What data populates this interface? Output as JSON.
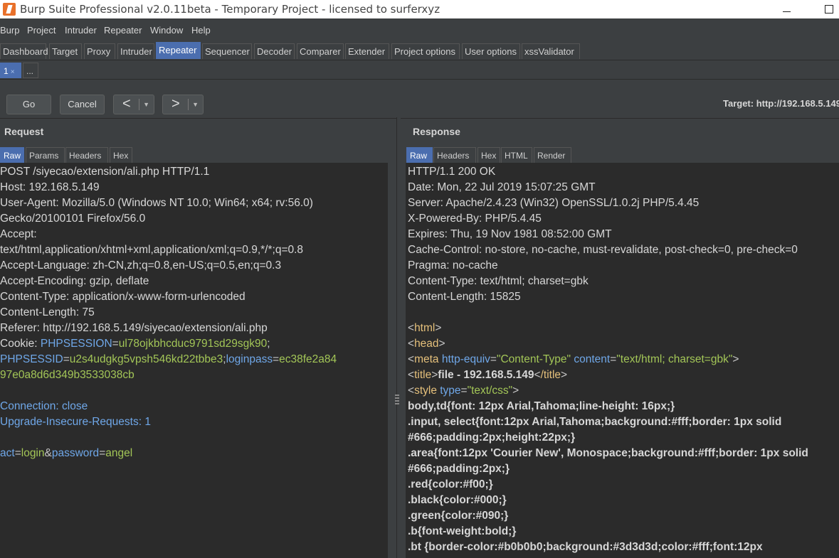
{
  "window": {
    "title": "Burp Suite Professional v2.0.11beta - Temporary Project - licensed to surferxyz"
  },
  "menubar": [
    "Burp",
    "Project",
    "Intruder",
    "Repeater",
    "Window",
    "Help"
  ],
  "main_tabs": [
    "Dashboard",
    "Target",
    "Proxy",
    "Intruder",
    "Repeater",
    "Sequencer",
    "Decoder",
    "Comparer",
    "Extender",
    "Project options",
    "User options",
    "xssValidator"
  ],
  "main_tabs_active": "Repeater",
  "repeater_tabs": {
    "tab1": "1",
    "close": "×",
    "more": "..."
  },
  "toolbar": {
    "go": "Go",
    "cancel": "Cancel",
    "back": "<",
    "forward": ">",
    "dropdown": "▼",
    "target": "Target: http://192.168.5.149"
  },
  "request": {
    "title": "Request",
    "tabs": [
      "Raw",
      "Params",
      "Headers",
      "Hex"
    ],
    "active_tab": "Raw",
    "lines": {
      "l1": "POST /siyecao/extension/ali.php HTTP/1.1",
      "l2": "Host: 192.168.5.149",
      "l3": "User-Agent: Mozilla/5.0 (Windows NT 10.0; Win64; x64; rv:56.0)",
      "l4": "Gecko/20100101 Firefox/56.0",
      "l5": "Accept:",
      "l6": "text/html,application/xhtml+xml,application/xml;q=0.9,*/*;q=0.8",
      "l7": "Accept-Language: zh-CN,zh;q=0.8,en-US;q=0.5,en;q=0.3",
      "l8": "Accept-Encoding: gzip, deflate",
      "l9": "Content-Type: application/x-www-form-urlencoded",
      "l10": "Content-Length: 75",
      "l11": "Referer: http://192.168.5.149/siyecao/extension/ali.php",
      "l12_name": "Cookie: ",
      "l12_key": "PHPSESSION",
      "l12_eq": "=",
      "l12_val": "ul78ojkbhcduc9791sd29sgk90",
      "l12_sep": ";",
      "l13_key": "PHPSESSID",
      "l13_eq": "=",
      "l13_val": "u2s4udgkg5vpsh546kd22tbbe3",
      "l13_sep": ";",
      "l13_key2": "loginpass",
      "l13_eq2": "=",
      "l13_val2": "ec38fe2a84",
      "l14": "97e0a8d6d349b3533038cb",
      "l16": "Connection: close",
      "l17": "Upgrade-Insecure-Requests: 1",
      "l19_k1": "act",
      "l19_e1": "=",
      "l19_v1": "login",
      "l19_amp": "&",
      "l19_k2": "password",
      "l19_e2": "=",
      "l19_v2": "angel"
    }
  },
  "response": {
    "title": "Response",
    "tabs": [
      "Raw",
      "Headers",
      "Hex",
      "HTML",
      "Render"
    ],
    "active_tab": "Raw",
    "lines": {
      "l1": "HTTP/1.1 200 OK",
      "l2": "Date: Mon, 22 Jul 2019 15:07:25 GMT",
      "l3": "Server: Apache/2.4.23 (Win32) OpenSSL/1.0.2j PHP/5.4.45",
      "l4": "X-Powered-By: PHP/5.4.45",
      "l5": "Expires: Thu, 19 Nov 1981 08:52:00 GMT",
      "l6": "Cache-Control: no-store, no-cache, must-revalidate, post-check=0, pre-check=0",
      "l7": "Pragma: no-cache",
      "l8": "Content-Type: text/html; charset=gbk",
      "l9": "Content-Length: 15825",
      "lt": "<",
      "gt": ">",
      "html": "html",
      "head": "head",
      "meta": "meta",
      "meta_attr1": " http-equiv",
      "meta_eq": "=",
      "meta_val1": "\"Content-Type\"",
      "meta_attr2": " content",
      "meta_val2": "\"text/html; charset=gbk\"",
      "title_open": "title",
      "title_text": "file - 192.168.5.149",
      "title_close": "/title",
      "style": "style",
      "style_attr": " type",
      "style_val": "\"text/css\"",
      "c1": "body,td{font: 12px Arial,Tahoma;line-height: 16px;}",
      "c2": ".input, select{font:12px Arial,Tahoma;background:#fff;border: 1px solid",
      "c3": "#666;padding:2px;height:22px;}",
      "c4": ".area{font:12px 'Courier New', Monospace;background:#fff;border: 1px solid",
      "c5": "#666;padding:2px;}",
      "c6": ".red{color:#f00;}",
      "c7": ".black{color:#000;}",
      "c8": ".green{color:#090;}",
      "c9": ".b{font-weight:bold;}",
      "c10": ".bt {border-color:#b0b0b0;background:#3d3d3d;color:#fff;font:12px"
    }
  }
}
